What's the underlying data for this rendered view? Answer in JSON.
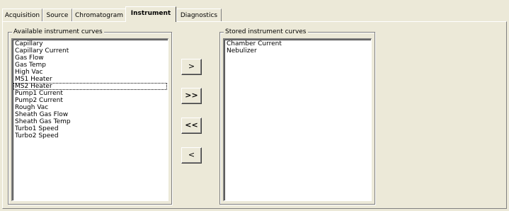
{
  "tabs": [
    {
      "label": "Acquisition"
    },
    {
      "label": "Source"
    },
    {
      "label": "Chromatogram"
    },
    {
      "label": "Instrument"
    },
    {
      "label": "Diagnostics"
    }
  ],
  "available": {
    "label": "Available instrument curves",
    "items": [
      "Capillary",
      "Capillary Current",
      "Gas Flow",
      "Gas Temp",
      "High Vac",
      "MS1 Heater",
      "MS2 Heater",
      "Pump1 Current",
      "Pump2 Current",
      "Rough Vac",
      "Sheath Gas Flow",
      "Sheath Gas Temp",
      "Turbo1 Speed",
      "Turbo2 Speed"
    ]
  },
  "stored": {
    "label": "Stored instrument curves",
    "items": [
      "Chamber Current",
      "Nebulizer"
    ]
  },
  "buttons": {
    "add": ">",
    "add_all": ">>",
    "remove_all": "<<",
    "remove": "<"
  }
}
